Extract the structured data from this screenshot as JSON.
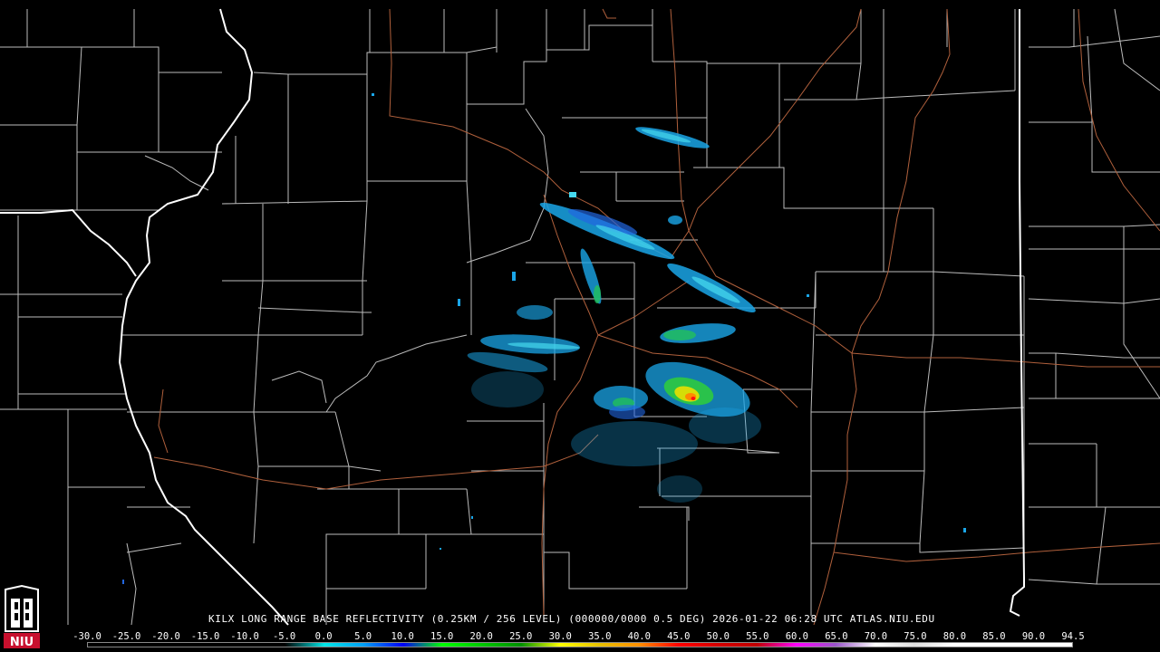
{
  "caption": "KILX LONG RANGE BASE REFLECTIVITY (0.25KM / 256 LEVEL) (000000/0000 0.5 DEG) 2026-01-22 06:28 UTC  ATLAS.NIU.EDU",
  "logo": {
    "text": "NIU",
    "colors": {
      "background": "#c8102e",
      "text": "#ffffff"
    }
  },
  "colorscale": {
    "labels": [
      "-30.0",
      "-25.0",
      "-20.0",
      "-15.0",
      "-10.0",
      "-5.0",
      "0.0",
      "5.0",
      "10.0",
      "15.0",
      "20.0",
      "25.0",
      "30.0",
      "35.0",
      "40.0",
      "45.0",
      "50.0",
      "55.0",
      "60.0",
      "65.0",
      "70.0",
      "75.0",
      "80.0",
      "85.0",
      "90.0",
      "94.5"
    ],
    "colors": [
      "#000000",
      "#000000",
      "#000000",
      "#000000",
      "#000000",
      "#000000",
      "#00e8e8",
      "#00a0f6",
      "#0000f6",
      "#00ff00",
      "#00c800",
      "#009000",
      "#ffff00",
      "#e7c000",
      "#ff9000",
      "#ff0000",
      "#d60000",
      "#c00000",
      "#ff00ff",
      "#9955c9",
      "#ffffff",
      "#e0e0e0",
      "#ffffff",
      "#ffffff",
      "#ffffff"
    ]
  },
  "map": {
    "colors": {
      "county": "#bcbcbc",
      "state": "#ffffff",
      "highway": "#b0603c",
      "background": "#000000"
    },
    "radar_site": "KILX"
  }
}
